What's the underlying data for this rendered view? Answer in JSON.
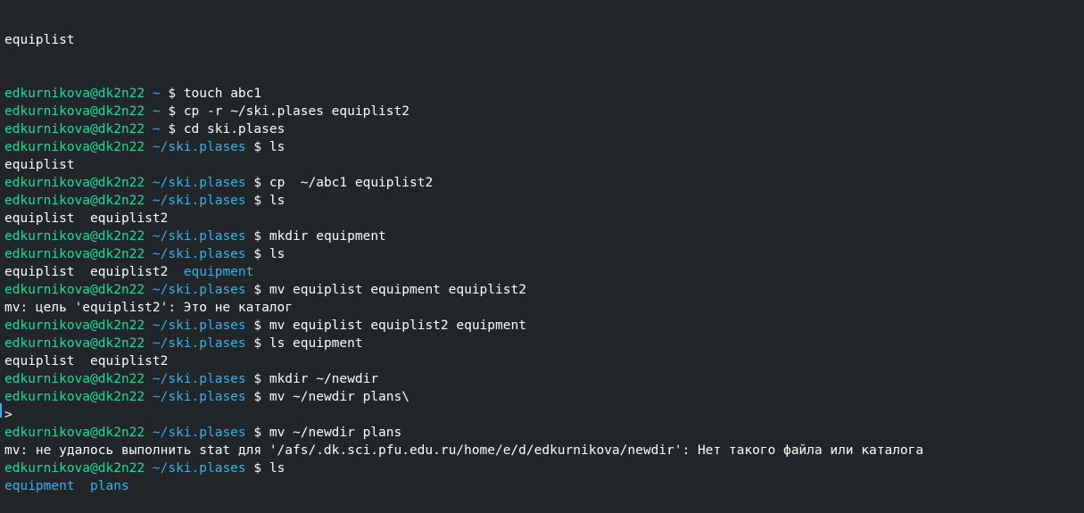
{
  "terminal": {
    "partial_top_line": "equiplist",
    "prompt_user": "edkurnikova@dk2n22",
    "prompt_sign": "$",
    "lines": [
      {
        "path": "~",
        "cmd": "touch abc1"
      },
      {
        "path": "~",
        "cmd": "cp -r ~/ski.plases equiplist2"
      },
      {
        "path": "~",
        "cmd": "cd ski.plases"
      },
      {
        "path": "~/ski.plases",
        "cmd": "ls"
      },
      {
        "output": "equiplist"
      },
      {
        "path": "~/ski.plases",
        "cmd": "cp  ~/abc1 equiplist2"
      },
      {
        "path": "~/ski.plases",
        "cmd": "ls"
      },
      {
        "output": "equiplist  equiplist2"
      },
      {
        "path": "~/ski.plases",
        "cmd": "mkdir equipment"
      },
      {
        "path": "~/ski.plases",
        "cmd": "ls"
      },
      {
        "output": "equiplist  equiplist2  ",
        "dir_output": "equipment"
      },
      {
        "path": "~/ski.plases",
        "cmd": "mv equiplist equipment equiplist2"
      },
      {
        "output": "mv: цель 'equiplist2': Это не каталог"
      },
      {
        "path": "~/ski.plases",
        "cmd": "mv equiplist equiplist2 equipment"
      },
      {
        "path": "~/ski.plases",
        "cmd": "ls equipment"
      },
      {
        "output": "equiplist  equiplist2"
      },
      {
        "path": "~/ski.plases",
        "cmd": "mkdir ~/newdir"
      },
      {
        "path": "~/ski.plases",
        "cmd": "mv ~/newdir plans\\"
      },
      {
        "output": ">"
      },
      {
        "path": "~/ski.plases",
        "cmd": "mv ~/newdir plans"
      },
      {
        "output": "mv: не удалось выполнить stat для '/afs/.dk.sci.pfu.edu.ru/home/e/d/edkurnikova/newdir': Нет такого файла или каталога"
      },
      {
        "path": "~/ski.plases",
        "cmd": "ls"
      },
      {
        "dir_output": "equipment  plans"
      }
    ]
  },
  "colors": {
    "background": "#232629",
    "user": "#1cdc9a",
    "path": "#3daee9",
    "text": "#fcfcfc",
    "directory": "#3daee9"
  }
}
